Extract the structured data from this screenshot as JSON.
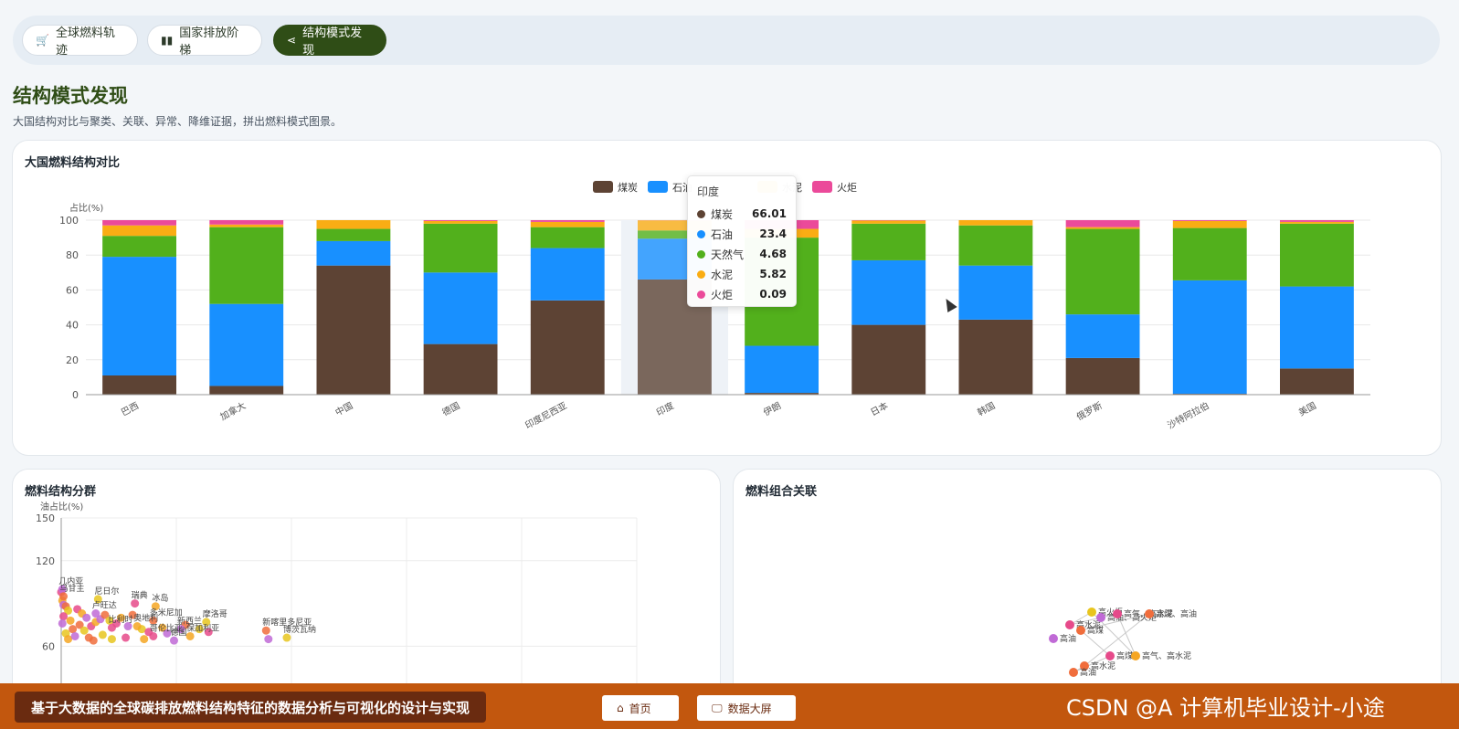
{
  "tabs": [
    {
      "label": "全球燃料轨迹",
      "icon": "cart-icon"
    },
    {
      "label": "国家排放阶梯",
      "icon": "bar-chart-icon"
    },
    {
      "label": "结构模式发现",
      "icon": "share-icon"
    }
  ],
  "page": {
    "title": "结构模式发现",
    "subtitle": "大国结构对比与聚类、关联、异常、降维证据，拼出燃料模式图景。"
  },
  "cards": {
    "structure_title": "大国燃料结构对比",
    "cluster_title": "燃料结构分群",
    "association_title": "燃料组合关联"
  },
  "tooltip": {
    "country": "印度",
    "rows": [
      {
        "name": "煤炭",
        "value": "66.01",
        "color": "#5d4334"
      },
      {
        "name": "石油",
        "value": "23.4",
        "color": "#1890ff"
      },
      {
        "name": "天然气",
        "value": "4.68",
        "color": "#52b01c"
      },
      {
        "name": "水泥",
        "value": "5.82",
        "color": "#faad14"
      },
      {
        "name": "火炬",
        "value": "0.09",
        "color": "#eb4a9a"
      }
    ]
  },
  "chart_data": [
    {
      "type": "bar",
      "stacked": true,
      "title": "大国燃料结构对比",
      "ylabel": "占比(%)",
      "ylim": [
        0,
        100
      ],
      "yticks": [
        0,
        20,
        40,
        60,
        80,
        100
      ],
      "categories": [
        "巴西",
        "加拿大",
        "中国",
        "德国",
        "印度尼西亚",
        "印度",
        "伊朗",
        "日本",
        "韩国",
        "俄罗斯",
        "沙特阿拉伯",
        "美国"
      ],
      "legend_position": "top-center",
      "legend_visible": [
        "煤炭",
        "石油",
        "水泥",
        "火炬"
      ],
      "series": [
        {
          "name": "煤炭",
          "color": "#5d4334",
          "values": [
            11,
            5,
            74,
            29,
            54,
            66.01,
            1,
            40,
            43,
            21,
            0.5,
            15
          ]
        },
        {
          "name": "石油",
          "color": "#1890ff",
          "values": [
            68,
            47,
            14,
            41,
            30,
            23.4,
            27,
            37,
            31,
            25,
            65,
            47
          ]
        },
        {
          "name": "天然气",
          "color": "#52b01c",
          "values": [
            12,
            44,
            7,
            28,
            12,
            4.68,
            62,
            21,
            23,
            49,
            30,
            36
          ]
        },
        {
          "name": "水泥",
          "color": "#faad14",
          "values": [
            6,
            1.5,
            5,
            1.5,
            3,
            5.82,
            5,
            1.8,
            3,
            1,
            4,
            1
          ]
        },
        {
          "name": "火炬",
          "color": "#eb4a9a",
          "values": [
            3,
            2.5,
            0,
            0.5,
            1,
            0.09,
            5,
            0.2,
            0,
            4,
            0.5,
            1
          ]
        }
      ],
      "highlight_category": "印度"
    },
    {
      "type": "scatter",
      "title": "燃料结构分群",
      "ylabel": "油占比(%)",
      "yticks_visible": [
        60,
        120,
        150
      ],
      "ylim": [
        0,
        150
      ],
      "grid": true,
      "labeled_points": [
        {
          "label": "几内亚",
          "x": 0.5,
          "y": 100
        },
        {
          "label": "乌甘主",
          "x": 1,
          "y": 95
        },
        {
          "label": "尼日尔",
          "x": 16,
          "y": 93
        },
        {
          "label": "瑞典",
          "x": 32,
          "y": 90
        },
        {
          "label": "冰岛",
          "x": 41,
          "y": 88
        },
        {
          "label": "卢旺达",
          "x": 15,
          "y": 83
        },
        {
          "label": "多米尼加",
          "x": 40,
          "y": 78
        },
        {
          "label": "摩洛哥",
          "x": 63,
          "y": 77
        },
        {
          "label": "比利时",
          "x": 22,
          "y": 73
        },
        {
          "label": "奥地利",
          "x": 33,
          "y": 74
        },
        {
          "label": "新西兰",
          "x": 52,
          "y": 72
        },
        {
          "label": "新喀里多尼亚",
          "x": 89,
          "y": 71
        },
        {
          "label": "博茨瓦纳",
          "x": 98,
          "y": 66
        },
        {
          "label": "哥伦比亚",
          "x": 40,
          "y": 67
        },
        {
          "label": "保加利亚",
          "x": 56,
          "y": 67
        },
        {
          "label": "德国",
          "x": 49,
          "y": 64
        }
      ],
      "points": [
        {
          "x": 0,
          "y": 98
        },
        {
          "x": 0.5,
          "y": 92
        },
        {
          "x": 1,
          "y": 89
        },
        {
          "x": 2,
          "y": 88
        },
        {
          "x": 3,
          "y": 85
        },
        {
          "x": 1,
          "y": 81
        },
        {
          "x": 4,
          "y": 78
        },
        {
          "x": 0.5,
          "y": 76
        },
        {
          "x": 5,
          "y": 72
        },
        {
          "x": 2,
          "y": 69
        },
        {
          "x": 7,
          "y": 86
        },
        {
          "x": 9,
          "y": 83
        },
        {
          "x": 11,
          "y": 80
        },
        {
          "x": 8,
          "y": 75
        },
        {
          "x": 10,
          "y": 71
        },
        {
          "x": 13,
          "y": 74
        },
        {
          "x": 15,
          "y": 77
        },
        {
          "x": 17,
          "y": 79
        },
        {
          "x": 19,
          "y": 82
        },
        {
          "x": 21,
          "y": 78
        },
        {
          "x": 24,
          "y": 76
        },
        {
          "x": 26,
          "y": 80
        },
        {
          "x": 29,
          "y": 74
        },
        {
          "x": 31,
          "y": 82
        },
        {
          "x": 35,
          "y": 72
        },
        {
          "x": 38,
          "y": 70
        },
        {
          "x": 44,
          "y": 73
        },
        {
          "x": 46,
          "y": 69
        },
        {
          "x": 54,
          "y": 75
        },
        {
          "x": 60,
          "y": 72
        },
        {
          "x": 64,
          "y": 70
        },
        {
          "x": 3,
          "y": 65
        },
        {
          "x": 6,
          "y": 67
        },
        {
          "x": 12,
          "y": 66
        },
        {
          "x": 18,
          "y": 68
        },
        {
          "x": 28,
          "y": 66
        },
        {
          "x": 36,
          "y": 65
        },
        {
          "x": 90,
          "y": 65
        },
        {
          "x": 14,
          "y": 64
        },
        {
          "x": 22,
          "y": 65
        }
      ]
    },
    {
      "type": "graph",
      "title": "燃料组合关联",
      "nodes": [
        "高油",
        "高水泥",
        "高火炬",
        "高煤",
        "高油、高火炬",
        "高气、高水泥",
        "高煤、高油"
      ]
    }
  ],
  "footer": {
    "title": "基于大数据的全球碳排放燃料结构特征的数据分析与可视化的设计与实现",
    "home_label": "首页",
    "screen_label": "数据大屏",
    "watermark": "CSDN @A 计算机毕业设计-小途"
  }
}
